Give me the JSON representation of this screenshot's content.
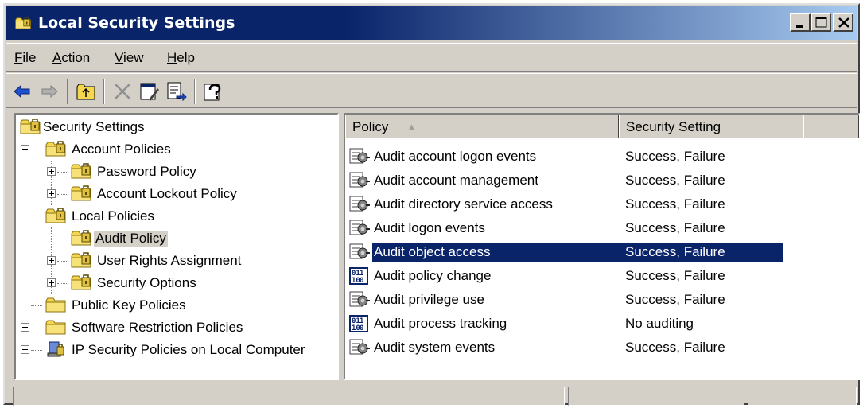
{
  "window": {
    "title": "Local Security Settings",
    "title_icon": "security-settings-icon",
    "controls": [
      "minimize-icon",
      "maximize-icon",
      "close-icon"
    ]
  },
  "menu": {
    "items": [
      {
        "label": "File",
        "key": "F",
        "rest": "ile"
      },
      {
        "label": "Action",
        "key": "A",
        "rest": "ction"
      },
      {
        "label": "View",
        "key": "V",
        "rest": "iew"
      },
      {
        "label": "Help",
        "key": "H",
        "rest": "elp"
      }
    ]
  },
  "toolbar": {
    "icons": [
      "back-arrow-icon",
      "forward-arrow-icon",
      "up-folder-icon",
      "delete-icon",
      "properties-icon",
      "export-list-icon",
      "help-icon"
    ]
  },
  "tree": {
    "root": "Security Settings",
    "account_policies": "Account Policies",
    "password_policy": "Password Policy",
    "account_lockout_policy": "Account Lockout Policy",
    "local_policies": "Local Policies",
    "audit_policy": "Audit Policy",
    "user_rights_assignment": "User Rights Assignment",
    "security_options": "Security Options",
    "public_key_policies": "Public Key Policies",
    "software_restriction_policies": "Software Restriction Policies",
    "ip_security_policies": "IP Security Policies on Local Computer"
  },
  "list": {
    "columns": {
      "policy": "Policy",
      "setting": "Security Setting"
    },
    "sort_indicator": "▲",
    "rows": [
      {
        "policy": "Audit account logon events",
        "setting": "Success, Failure",
        "icon": "policy-icon"
      },
      {
        "policy": "Audit account management",
        "setting": "Success, Failure",
        "icon": "policy-icon"
      },
      {
        "policy": "Audit directory service access",
        "setting": "Success, Failure",
        "icon": "policy-icon"
      },
      {
        "policy": "Audit logon events",
        "setting": "Success, Failure",
        "icon": "policy-icon"
      },
      {
        "policy": "Audit object access",
        "setting": "Success, Failure",
        "icon": "policy-icon",
        "selected": true
      },
      {
        "policy": "Audit policy change",
        "setting": "Success, Failure",
        "icon": "binary-policy-icon"
      },
      {
        "policy": "Audit privilege use",
        "setting": "Success, Failure",
        "icon": "policy-icon"
      },
      {
        "policy": "Audit process tracking",
        "setting": "No auditing",
        "icon": "binary-policy-icon"
      },
      {
        "policy": "Audit system events",
        "setting": "Success, Failure",
        "icon": "policy-icon"
      }
    ]
  },
  "colors": {
    "title_bar": "#0a246a",
    "selection": "#0a246a",
    "face": "#d4d0c8",
    "folder_yellow": "#f5d74f"
  }
}
